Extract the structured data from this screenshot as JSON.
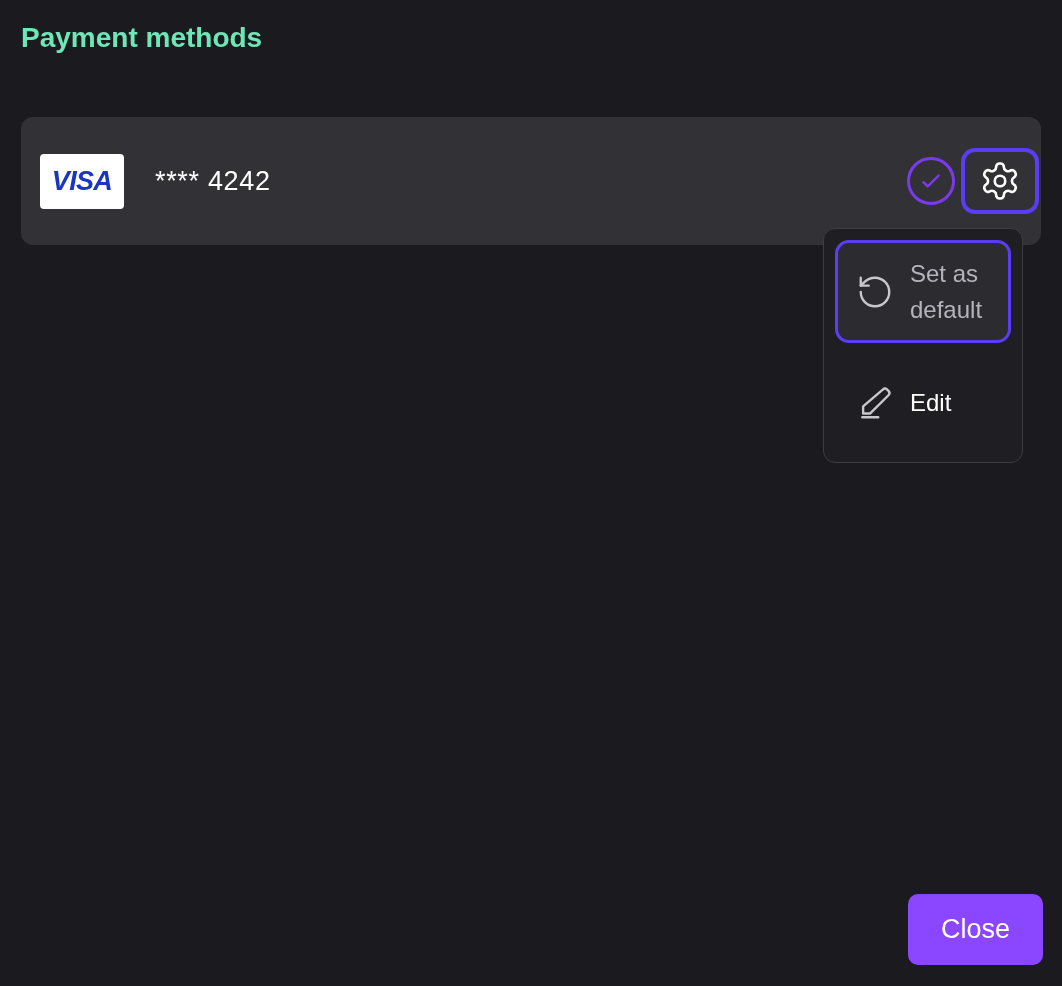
{
  "title": "Payment methods",
  "cards": [
    {
      "brand": "VISA",
      "number": "**** 4242",
      "is_default": true,
      "settings_focused": true,
      "menu_open": true
    }
  ],
  "menu": [
    {
      "kind": "default",
      "label": "Set as default",
      "selected": true,
      "disabled": true
    },
    {
      "kind": "edit",
      "label": "Edit",
      "selected": false,
      "disabled": false
    }
  ],
  "close_button": "Close"
}
